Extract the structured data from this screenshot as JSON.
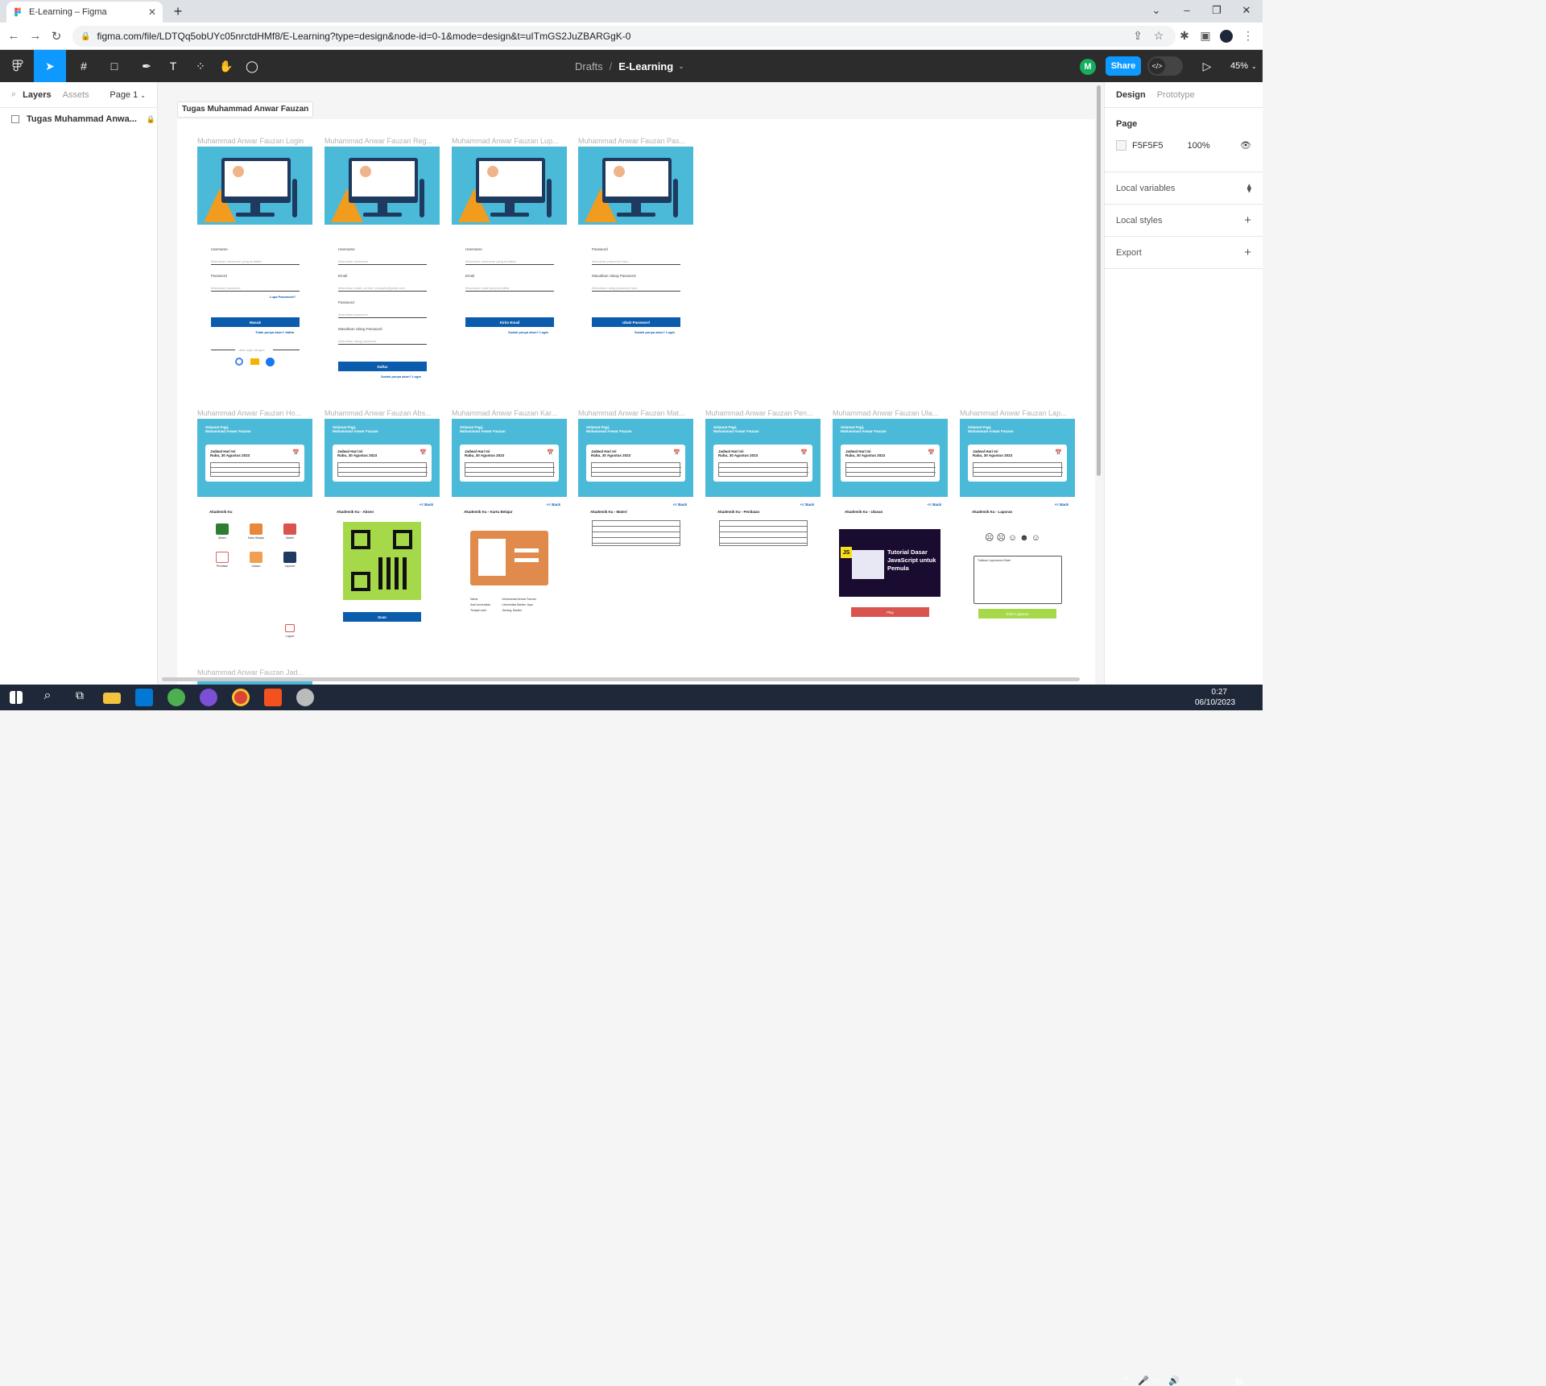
{
  "browser": {
    "tab_title": "E-Learning – Figma",
    "url": "figma.com/file/LDTQq5obUYc05nrctdHMf8/E-Learning?type=design&node-id=0-1&mode=design&t=uITmGS2JuZBARGgK-0"
  },
  "toolbar": {
    "drafts": "Drafts",
    "separator": "/",
    "file_name": "E-Learning",
    "avatar_initial": "M",
    "share_label": "Share",
    "zoom": "45%"
  },
  "left_panel": {
    "tab_layers": "Layers",
    "tab_assets": "Assets",
    "page_selector": "Page 1",
    "layers": [
      {
        "name": "Tugas Muhammad Anwa..."
      }
    ]
  },
  "right_panel": {
    "tab_design": "Design",
    "tab_prototype": "Prototype",
    "page_heading": "Page",
    "page_color": "F5F5F5",
    "page_opacity": "100%",
    "local_variables": "Local variables",
    "local_styles": "Local styles",
    "export": "Export"
  },
  "canvas": {
    "section_name": "Tugas Muhammad Anwar Fauzan",
    "row1_frames": [
      {
        "label": "Muhammad Anwar Fauzan Login"
      },
      {
        "label": "Muhammad Anwar Fauzan Reg..."
      },
      {
        "label": "Muhammad Anwar Fauzan Lup..."
      },
      {
        "label": "Muhammad Anwar Fauzan Pas..."
      }
    ],
    "row2_frames": [
      {
        "label": "Muhammad Anwar Fauzan Ho...",
        "subtitle": "Akademik Ku"
      },
      {
        "label": "Muhammad Anwar Fauzan Abs...",
        "subtitle": "Akademik Ku - Absen"
      },
      {
        "label": "Muhammad Anwar Fauzan Kar...",
        "subtitle": "Akademik Ku - Kartu Belajar"
      },
      {
        "label": "Muhammad Anwar Fauzan Mat...",
        "subtitle": "Akademik Ku - Materi"
      },
      {
        "label": "Muhammad Anwar Fauzan Pen...",
        "subtitle": "Akademik Ku - Penilaian"
      },
      {
        "label": "Muhammad Anwar Fauzan Ula...",
        "subtitle": "Akademik Ku - Ulasan"
      },
      {
        "label": "Muhammad Anwar Fauzan Lap...",
        "subtitle": "Akademik Ku - Laporan"
      }
    ],
    "row3_label": "Muhammad Anwar Fauzan Jad...",
    "login": {
      "username": "Username",
      "username_ph": "Masukkan username yang terdaftar",
      "password": "Password",
      "password_ph": "Masukkan password",
      "forgot": "Lupa Password?",
      "button": "Masuk",
      "no_account": "Tidak punya akun? daftar",
      "or_login": "atau login dengan"
    },
    "register": {
      "username": "Username",
      "username_ph": "Masukkan username",
      "email": "Email",
      "email_ph": "Masukkan email, contoh: example@gmail.com",
      "password": "Password",
      "password_ph": "Masukkan password",
      "confirm": "Masukkan Ulang Password",
      "confirm_ph": "Masukkan ulang password",
      "button": "Daftar",
      "has_account": "Sudah punya akun? Login"
    },
    "forgot": {
      "username": "Username",
      "username_ph": "Masukkan username yang terdaftar",
      "email": "Email",
      "email_ph": "Masukkan email yang terdaftar",
      "button": "Kirim Email",
      "has_account": "Sudah punya akun? Login"
    },
    "change_password": {
      "password": "Password",
      "password_ph": "Masukkan password baru",
      "confirm": "Masukkan Ulang Password",
      "confirm_ph": "Masukkan ulang password baru",
      "button": "Ubah Password",
      "has_account": "Sudah punya akun? Login"
    },
    "dashboard": {
      "greeting": "Selamat Pagi,",
      "name": "Muhammad Anwar Fauzan",
      "today": "Jadwal Hari Ini",
      "date": "Rabu, 30 Agustus 2023",
      "back": "<< Back"
    },
    "home_menu": [
      "Absen",
      "Kartu Belajar",
      "Materi",
      "Penilaian",
      "Ulasan",
      "Laporan"
    ],
    "logout": "Logout",
    "scan": "Scan",
    "kartu": {
      "nama_label": "Nama",
      "nama": ": Muhammad Anwar Fauzan",
      "asal_label": "Asal Universitas",
      "asal": ": Universitas Banten Jaya",
      "tempat_label": "Tempat Lahir",
      "tempat": ": Serang, Banten"
    },
    "ulasan": {
      "video_title": "Tutorial Dasar JavaScript untuk Pemula",
      "badge": "JS",
      "play": "Play"
    },
    "laporan": {
      "placeholder": "Tuliskan Laporanmu Disini",
      "button": "Kirim Laporan"
    }
  },
  "taskbar": {
    "time": "0:27",
    "date": "06/10/2023"
  }
}
